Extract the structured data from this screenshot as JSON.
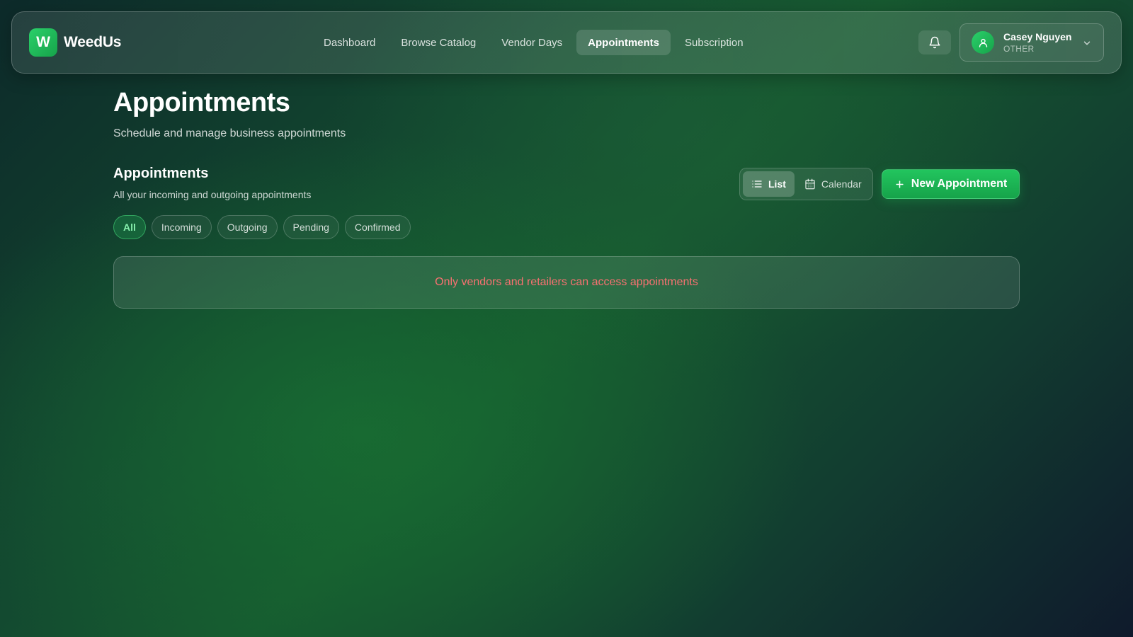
{
  "brand": {
    "logo_letter": "W",
    "name": "WeedUs"
  },
  "nav": {
    "items": [
      {
        "label": "Dashboard",
        "active": false
      },
      {
        "label": "Browse Catalog",
        "active": false
      },
      {
        "label": "Vendor Days",
        "active": false
      },
      {
        "label": "Appointments",
        "active": true
      },
      {
        "label": "Subscription",
        "active": false
      }
    ]
  },
  "header_actions": {
    "notifications_icon": "bell-icon",
    "user": {
      "name": "Casey Nguyen",
      "role": "OTHER",
      "avatar_icon": "user-icon",
      "menu_icon": "chevron-down-icon"
    }
  },
  "page": {
    "title": "Appointments",
    "subtitle": "Schedule and manage business appointments"
  },
  "section": {
    "title": "Appointments",
    "subtitle": "All your incoming and outgoing appointments"
  },
  "view_toggle": {
    "list_label": "List",
    "calendar_label": "Calendar",
    "selected": "List"
  },
  "new_button": {
    "label": "New Appointment",
    "icon": "plus-icon"
  },
  "filters": {
    "items": [
      {
        "label": "All",
        "active": true
      },
      {
        "label": "Incoming",
        "active": false
      },
      {
        "label": "Outgoing",
        "active": false
      },
      {
        "label": "Pending",
        "active": false
      },
      {
        "label": "Confirmed",
        "active": false
      }
    ]
  },
  "notice": {
    "message": "Only vendors and retailers can access appointments"
  },
  "colors": {
    "accent": "#22c55e",
    "accent_dark": "#16a34a",
    "error_text": "#f87171",
    "active_chip_text": "#86efac"
  }
}
